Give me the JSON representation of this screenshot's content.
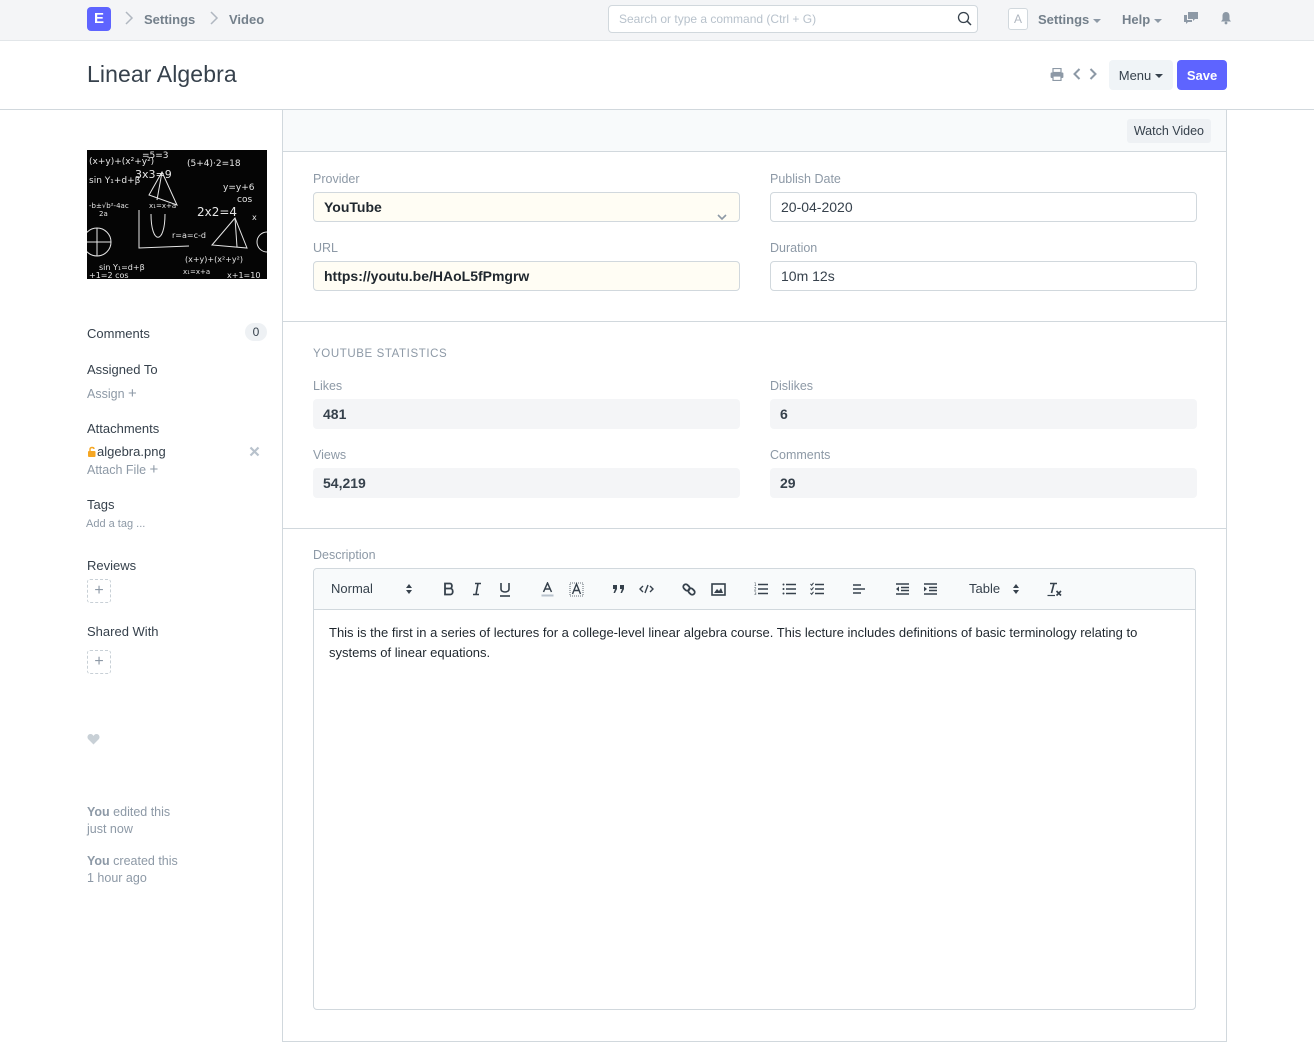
{
  "navbar": {
    "logo_letter": "E",
    "breadcrumbs": [
      "Settings",
      "Video"
    ],
    "search_placeholder": "Search or type a command (Ctrl + G)",
    "avatar_letter": "A",
    "settings_label": "Settings",
    "help_label": "Help"
  },
  "page": {
    "title": "Linear Algebra",
    "menu_label": "Menu",
    "save_label": "Save",
    "accent_color": "#5e64ff"
  },
  "sidebar": {
    "image_alt": "algebra.png",
    "comments_label": "Comments",
    "comments_count": "0",
    "assigned_to_label": "Assigned To",
    "assign_label": "Assign",
    "attachments_label": "Attachments",
    "attachment_file": "algebra.png",
    "attach_file_label": "Attach File",
    "tags_label": "Tags",
    "add_tag_label": "Add a tag ...",
    "reviews_label": "Reviews",
    "shared_with_label": "Shared With",
    "activity": [
      {
        "who": "You",
        "action": " edited this",
        "when": "just now"
      },
      {
        "who": "You",
        "action": " created this",
        "when": "1 hour ago"
      }
    ]
  },
  "form": {
    "watch_video_label": "Watch Video",
    "provider": {
      "label": "Provider",
      "value": "YouTube"
    },
    "url": {
      "label": "URL",
      "value": "https://youtu.be/HAoL5fPmgrw"
    },
    "publish_date": {
      "label": "Publish Date",
      "value": "20-04-2020"
    },
    "duration": {
      "label": "Duration",
      "value": "10m 12s"
    },
    "stats_section_title": "YOUTUBE STATISTICS",
    "likes": {
      "label": "Likes",
      "value": "481"
    },
    "dislikes": {
      "label": "Dislikes",
      "value": "6"
    },
    "views": {
      "label": "Views",
      "value": "54,219"
    },
    "comments": {
      "label": "Comments",
      "value": "29"
    },
    "description": {
      "label": "Description",
      "format_select": "Normal",
      "table_select": "Table",
      "content": "This is the first in a series of lectures for a college-level linear algebra course. This lecture includes definitions of basic terminology relating to systems of linear equations."
    }
  }
}
